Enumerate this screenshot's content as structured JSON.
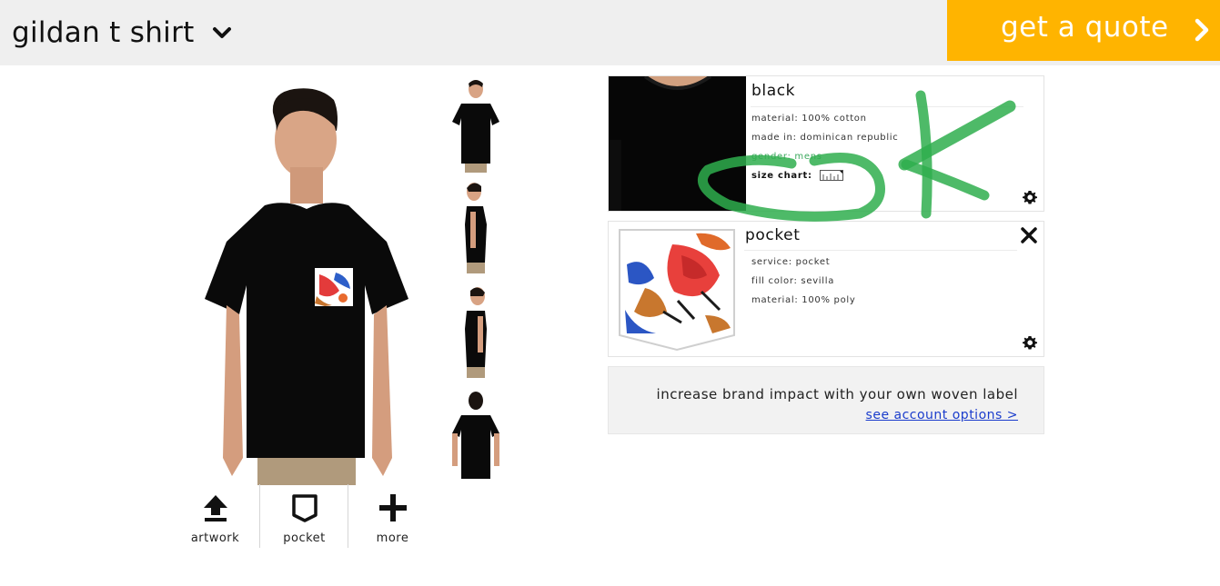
{
  "header": {
    "product_title": "gildan t shirt",
    "quote_button": "get a quote",
    "accent_color": "#ffb400"
  },
  "preview": {
    "thumbnails": [
      "front",
      "side",
      "side",
      "back"
    ]
  },
  "tools": [
    {
      "label": "artwork",
      "icon": "upload-arrow-icon"
    },
    {
      "label": "pocket",
      "icon": "pocket-icon"
    },
    {
      "label": "more",
      "icon": "plus-icon"
    }
  ],
  "garment_card": {
    "title": "black",
    "material": "material: 100% cotton",
    "made_in": "made in: dominican republic",
    "gender": "gender: mens",
    "size_chart": "size chart:"
  },
  "pocket_card": {
    "title": "pocket",
    "service": "service: pocket",
    "fill_color": "fill color: sevilla",
    "material": "material: 100% poly"
  },
  "promo": {
    "text": "increase brand impact with your own woven label",
    "link": "see account options >"
  }
}
